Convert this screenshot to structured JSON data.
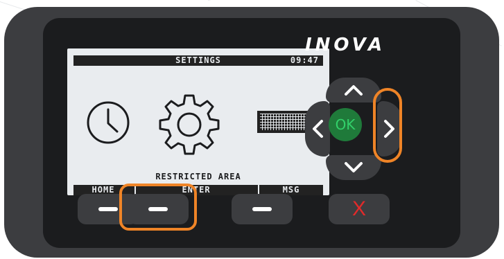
{
  "brand": {
    "logo_text": "INOVA"
  },
  "screen": {
    "title": "SETTINGS",
    "time": "09:47",
    "caption": "RESTRICTED AREA",
    "icons": [
      "clock-icon",
      "gear-icon",
      "grid-icon"
    ],
    "softkeys": [
      "HOME",
      "ENTER",
      "MSG"
    ]
  },
  "dpad": {
    "center_label": "OK",
    "keys": [
      "up",
      "down",
      "left",
      "right"
    ],
    "highlighted": "right"
  },
  "buttons": {
    "cancel_label": "X",
    "highlighted": "softkey-2"
  },
  "colors": {
    "body": "#3c3d40",
    "faceplate": "#1b1c1e",
    "lcd": "#e9ecef",
    "highlight": "#ef8427",
    "ok_bg": "#1f7a3a",
    "ok_text": "#32d06a",
    "cancel": "#e12a2a"
  }
}
